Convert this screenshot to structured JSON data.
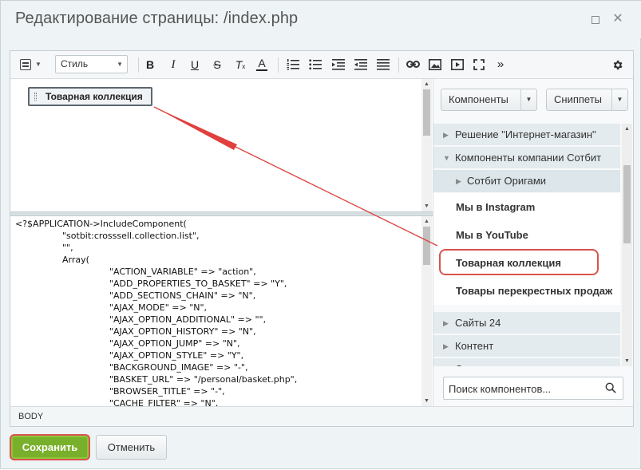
{
  "window": {
    "title": "Редактирование страницы: /index.php",
    "maximize_icon": "maximize-icon",
    "close_icon": "close-icon",
    "close_glyph": "✕"
  },
  "toolbar": {
    "style_select_value": "Стиль",
    "bold": "B",
    "italic": "I",
    "underline": "U",
    "strike": "S",
    "remove_format": "T",
    "font_color": "A",
    "more": "»",
    "icons": [
      "source-mode-icon",
      "bold-icon",
      "italic-icon",
      "underline-icon",
      "strikethrough-icon",
      "remove-format-icon",
      "font-color-icon",
      "ordered-list-icon",
      "bullet-list-icon",
      "outdent-icon",
      "indent-icon",
      "justify-icon",
      "link-icon",
      "image-icon",
      "video-icon",
      "fullscreen-icon",
      "more-icon",
      "settings-icon"
    ]
  },
  "visual": {
    "component_chip_label": "Товарная коллекция"
  },
  "code_lines": [
    "<?$APPLICATION->IncludeComponent(",
    "\t\"sotbit:crosssell.collection.list\",",
    "\t\"\",",
    "\tArray(",
    "\t\t\"ACTION_VARIABLE\" => \"action\",",
    "\t\t\"ADD_PROPERTIES_TO_BASKET\" => \"Y\",",
    "\t\t\"ADD_SECTIONS_CHAIN\" => \"N\",",
    "\t\t\"AJAX_MODE\" => \"N\",",
    "\t\t\"AJAX_OPTION_ADDITIONAL\" => \"\",",
    "\t\t\"AJAX_OPTION_HISTORY\" => \"N\",",
    "\t\t\"AJAX_OPTION_JUMP\" => \"N\",",
    "\t\t\"AJAX_OPTION_STYLE\" => \"Y\",",
    "\t\t\"BACKGROUND_IMAGE\" => \"-\",",
    "\t\t\"BASKET_URL\" => \"/personal/basket.php\",",
    "\t\t\"BROWSER_TITLE\" => \"-\",",
    "\t\t\"CACHE_FILTER\" => \"N\","
  ],
  "statusbar": {
    "path": "BODY"
  },
  "side": {
    "components_button": "Компоненты",
    "snippets_button": "Сниппеты",
    "tree": [
      {
        "label": "Решение \"Интернет-магазин\"",
        "kind": "group",
        "expanded": false
      },
      {
        "label": "Компоненты компании Сотбит",
        "kind": "group",
        "expanded": true
      },
      {
        "label": "Сотбит Оригами",
        "kind": "sub",
        "expanded": false
      },
      {
        "label": "Мы в Instagram",
        "kind": "leaf"
      },
      {
        "label": "Мы в YouTube",
        "kind": "leaf"
      },
      {
        "label": "Товарная коллекция",
        "kind": "leaf",
        "highlighted": true
      },
      {
        "label": "Товары перекрестных продаж",
        "kind": "leaf"
      },
      {
        "label": "Сайты 24",
        "kind": "group",
        "expanded": false
      },
      {
        "label": "Контент",
        "kind": "group",
        "expanded": false
      },
      {
        "label": "Сервисы",
        "kind": "group",
        "expanded": false
      }
    ],
    "search_placeholder": "Поиск компонентов..."
  },
  "footer": {
    "save_button": "Сохранить",
    "cancel_button": "Отменить"
  },
  "colors": {
    "save_button": "#79b02b",
    "highlight": "#d9534f",
    "annotation_arrow": "#e0413e"
  }
}
